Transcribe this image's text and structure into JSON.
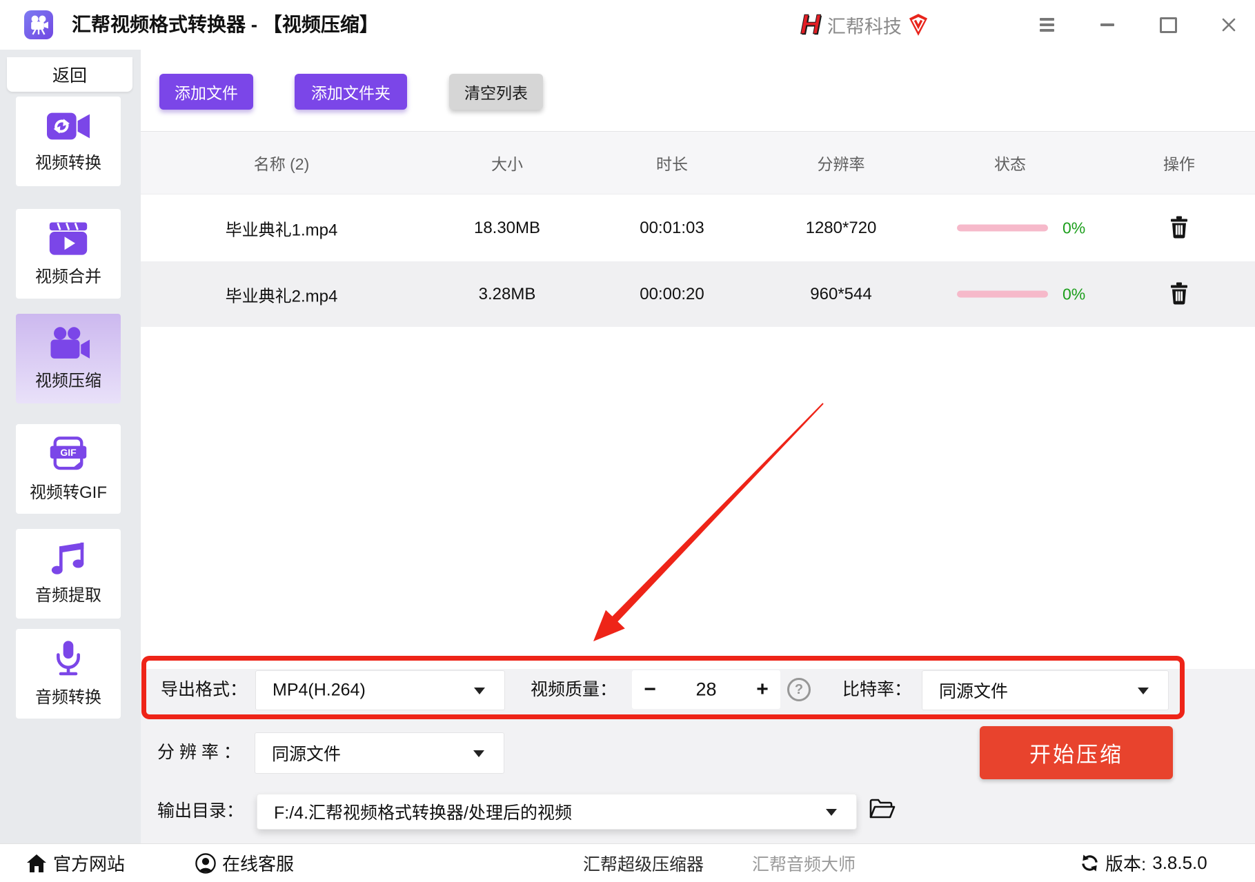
{
  "colors": {
    "accent": "#7b46e8",
    "annotation-red": "#ee2418",
    "start-red": "#e8432d",
    "progress-pink": "#f6b9ca",
    "percent-green": "#1b9e1b",
    "sidebar-bg": "#e8eaed",
    "panel-gray": "#f2f2f4"
  },
  "titlebar": {
    "title": "汇帮视频格式转换器 - 【视频压缩】",
    "logo_letter": "H",
    "brand": "汇帮科技"
  },
  "sidebar": {
    "back_label": "返回",
    "items": [
      {
        "label": "视频转换"
      },
      {
        "label": "视频合并"
      },
      {
        "label": "视频压缩"
      },
      {
        "label": "视频转GIF"
      },
      {
        "label": "音频提取"
      },
      {
        "label": "音频转换"
      }
    ]
  },
  "toolbar": {
    "add_file": "添加文件",
    "add_folder": "添加文件夹",
    "clear_list": "清空列表"
  },
  "table": {
    "headers": [
      "名称 (2)",
      "大小",
      "时长",
      "分辨率",
      "状态",
      "操作"
    ],
    "rows": [
      {
        "name": "毕业典礼1.mp4",
        "size": "18.30MB",
        "duration": "00:01:03",
        "resolution": "1280*720",
        "progress": "0%"
      },
      {
        "name": "毕业典礼2.mp4",
        "size": "3.28MB",
        "duration": "00:00:20",
        "resolution": "960*544",
        "progress": "0%"
      }
    ]
  },
  "settings": {
    "export_format_label": "导出格式：",
    "export_format_value": "MP4(H.264)",
    "quality_label": "视频质量：",
    "quality_minus": "−",
    "quality_value": "28",
    "quality_plus": "+",
    "help_glyph": "?",
    "bitrate_label": "比特率：",
    "bitrate_value": "同源文件",
    "resolution_label": "分 辨 率 ：",
    "resolution_value": "同源文件",
    "output_label": "输出目录：",
    "output_value": "F:/4.汇帮视频格式转换器/处理后的视频",
    "start_label": "开始压缩"
  },
  "footer": {
    "official_site": "官方网站",
    "online_support": "在线客服",
    "super_compressor": "汇帮超级压缩器",
    "audio_master": "汇帮音频大师",
    "version_label": "版本:",
    "version_value": "3.8.5.0"
  }
}
